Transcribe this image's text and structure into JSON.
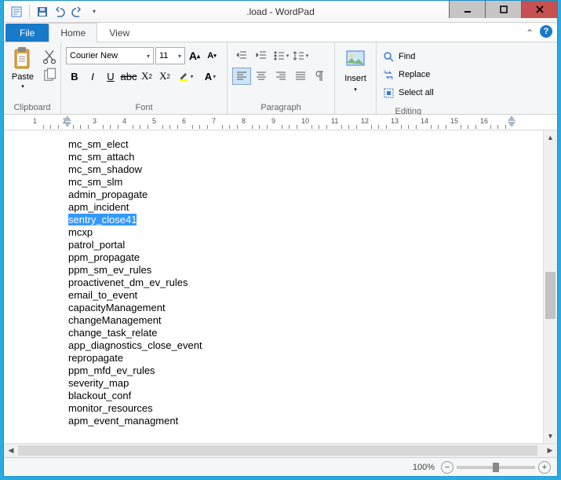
{
  "title": ".load - WordPad",
  "tabs": {
    "file": "File",
    "home": "Home",
    "view": "View"
  },
  "clipboard": {
    "paste": "Paste",
    "label": "Clipboard"
  },
  "font": {
    "name": "Courier New",
    "size": "11",
    "label": "Font"
  },
  "paragraph": {
    "label": "Paragraph"
  },
  "insert": {
    "label": "Insert"
  },
  "editing": {
    "find": "Find",
    "replace": "Replace",
    "selectall": "Select all",
    "label": "Editing"
  },
  "ruler": [
    "1",
    "2",
    "3",
    "4",
    "5",
    "6",
    "7",
    "8",
    "9",
    "10",
    "11",
    "12",
    "13",
    "14",
    "15",
    "16"
  ],
  "lines": [
    "mc_sm_elect",
    "mc_sm_attach",
    "mc_sm_shadow",
    "mc_sm_slm",
    "admin_propagate",
    "apm_incident",
    "sentry_close41",
    "mcxp",
    "patrol_portal",
    "ppm_propagate",
    "ppm_sm_ev_rules",
    "proactivenet_dm_ev_rules",
    "email_to_event",
    "capacityManagement",
    "changeManagement",
    "change_task_relate",
    "app_diagnostics_close_event",
    "repropagate",
    "ppm_mfd_ev_rules",
    "severity_map",
    "blackout_conf",
    "monitor_resources",
    "apm_event_managment"
  ],
  "selected_index": 6,
  "zoom": "100%"
}
